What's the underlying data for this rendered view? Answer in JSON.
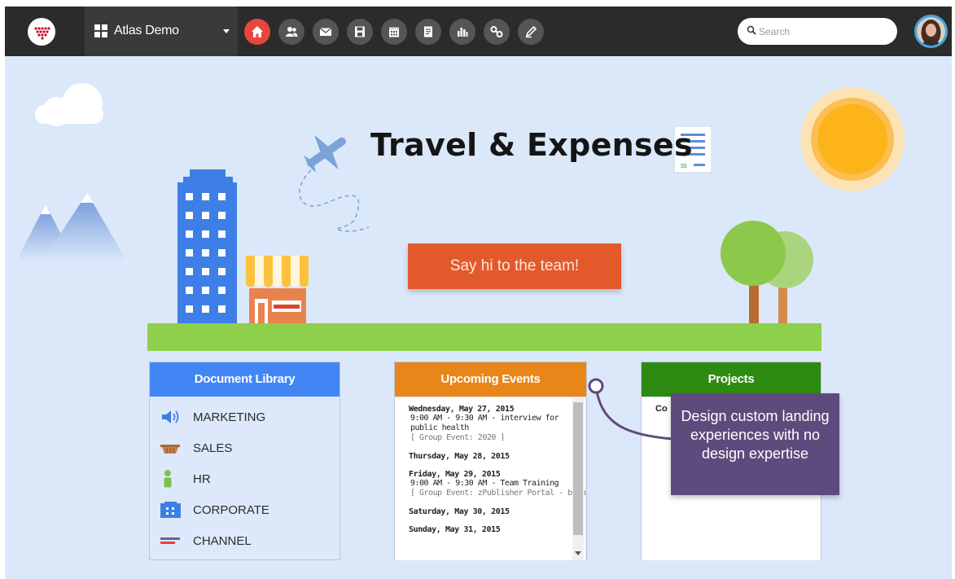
{
  "app": {
    "site_name": "Atlas Demo",
    "nav_icons": [
      "home-icon",
      "people-icon",
      "mail-icon",
      "save-icon",
      "calendar-icon",
      "document-icon",
      "bar-chart-icon",
      "link-icon",
      "edit-icon"
    ],
    "search_placeholder": "Search"
  },
  "page": {
    "title": "Travel & Expenses",
    "cta_label": "Say hi to the team!"
  },
  "document_library": {
    "title": "Document Library",
    "header_color": "#4285f4",
    "items": [
      {
        "label": "MARKETING",
        "icon": "megaphone-icon"
      },
      {
        "label": "SALES",
        "icon": "basket-icon"
      },
      {
        "label": "HR",
        "icon": "person-icon"
      },
      {
        "label": "CORPORATE",
        "icon": "building-icon"
      },
      {
        "label": "CHANNEL",
        "icon": "channel-icon"
      }
    ]
  },
  "upcoming_events": {
    "title": "Upcoming Events",
    "header_color": "#e8861a",
    "days": [
      {
        "date": "Wednesday, May 27, 2015",
        "events": [
          {
            "time_title": "9:00 AM - 9:30 AM - interview for public health",
            "group": "[ Group Event: 2020 ]"
          }
        ]
      },
      {
        "date": "Thursday, May 28, 2015",
        "events": []
      },
      {
        "date": "Friday, May 29, 2015",
        "events": [
          {
            "time_title": "9:00 AM - 9:30 AM - Team Training",
            "group": "[ Group Event: zPublisher Portal - blank"
          }
        ]
      },
      {
        "date": "Saturday, May 30, 2015",
        "events": []
      },
      {
        "date": "Sunday, May 31, 2015",
        "events": []
      }
    ]
  },
  "projects": {
    "title": "Projects",
    "header_color": "#2e8b12",
    "partial_text": "Co"
  },
  "callout": {
    "text": "Design custom landing experiences with no design expertise",
    "color": "#5f4a7e"
  }
}
